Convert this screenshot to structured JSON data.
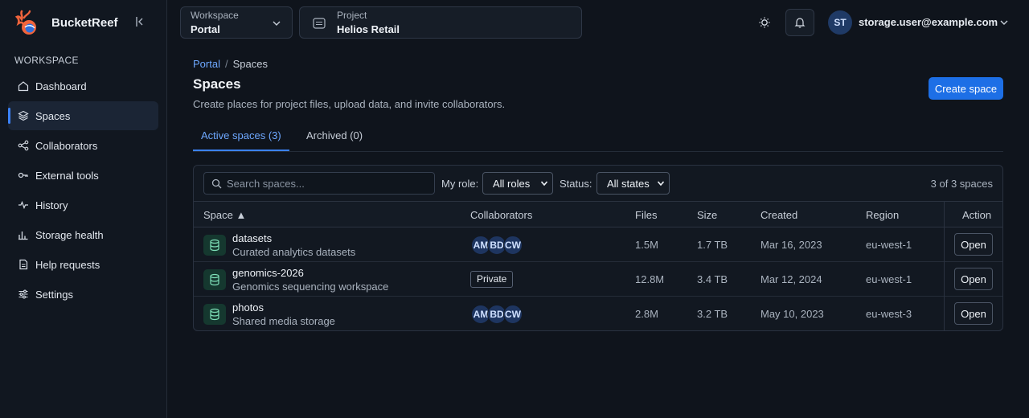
{
  "app": {
    "name": "BucketReef"
  },
  "sidebar": {
    "section_label": "WORKSPACE",
    "items": [
      {
        "label": "Dashboard",
        "icon": "home-icon",
        "active": false
      },
      {
        "label": "Spaces",
        "icon": "layers-icon",
        "active": true
      },
      {
        "label": "Collaborators",
        "icon": "share-icon",
        "active": false
      },
      {
        "label": "External tools",
        "icon": "key-icon",
        "active": false
      },
      {
        "label": "History",
        "icon": "activity-icon",
        "active": false
      },
      {
        "label": "Storage health",
        "icon": "bar-chart-icon",
        "active": false
      },
      {
        "label": "Help requests",
        "icon": "document-icon",
        "active": false
      },
      {
        "label": "Settings",
        "icon": "sliders-icon",
        "active": false
      }
    ]
  },
  "topbar": {
    "workspace": {
      "label": "Workspace",
      "value": "Portal"
    },
    "project": {
      "label": "Project",
      "value": "Helios Retail"
    },
    "user": {
      "initials": "ST",
      "email": "storage.user@example.com"
    }
  },
  "breadcrumb": {
    "parent": "Portal",
    "separator": "/",
    "current": "Spaces"
  },
  "page": {
    "title": "Spaces",
    "subtitle": "Create places for project files, upload data, and invite collaborators.",
    "create_button": "Create space"
  },
  "tabs": [
    {
      "label": "Active spaces (3)",
      "active": true
    },
    {
      "label": "Archived (0)",
      "active": false
    }
  ],
  "filters": {
    "search_placeholder": "Search spaces...",
    "role_label": "My role:",
    "role_value": "All roles",
    "status_label": "Status:",
    "status_value": "All states",
    "count_text": "3 of 3 spaces"
  },
  "table": {
    "headers": {
      "space": "Space ▲",
      "collaborators": "Collaborators",
      "files": "Files",
      "size": "Size",
      "created": "Created",
      "region": "Region",
      "action": "Action"
    },
    "rows": [
      {
        "name": "datasets",
        "description": "Curated analytics datasets",
        "collaborators": [
          "AM",
          "BD",
          "CW"
        ],
        "private_label": "",
        "files": "1.5M",
        "size": "1.7 TB",
        "created": "Mar 16, 2023",
        "region": "eu-west-1",
        "action": "Open"
      },
      {
        "name": "genomics-2026",
        "description": "Genomics sequencing workspace",
        "collaborators": [],
        "private_label": "Private",
        "files": "12.8M",
        "size": "3.4 TB",
        "created": "Mar 12, 2024",
        "region": "eu-west-1",
        "action": "Open"
      },
      {
        "name": "photos",
        "description": "Shared media storage",
        "collaborators": [
          "AM",
          "BD",
          "CW"
        ],
        "private_label": "",
        "files": "2.8M",
        "size": "3.2 TB",
        "created": "May 10, 2023",
        "region": "eu-west-3",
        "action": "Open"
      }
    ]
  },
  "colors": {
    "accent": "#3b82f6",
    "link": "#6ea8ff",
    "primary_button": "#1d6fe6",
    "background": "#0f141c",
    "sidebar_bg": "#111720"
  }
}
